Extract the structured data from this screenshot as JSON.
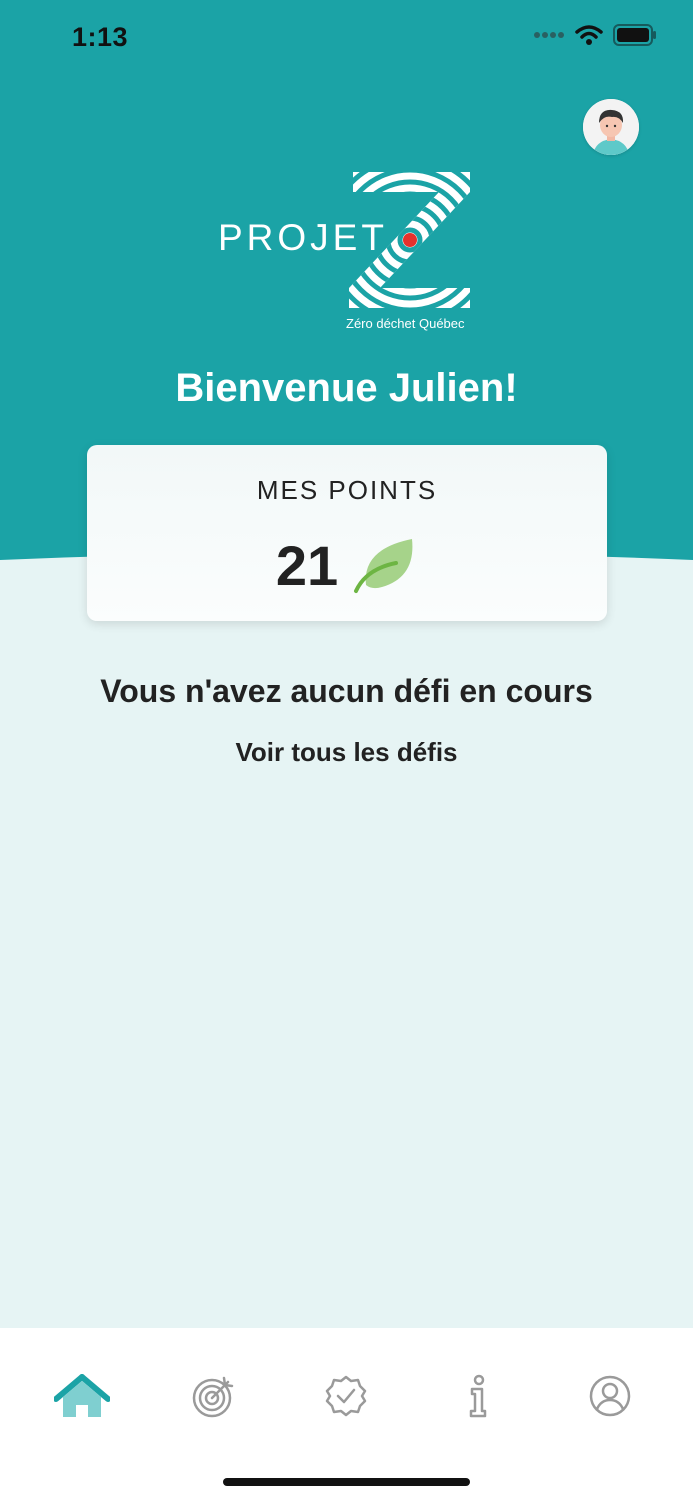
{
  "status_bar": {
    "time": "1:13"
  },
  "logo": {
    "wordmark": "PROJET",
    "tagline": "Zéro déchet Québec"
  },
  "welcome": "Bienvenue Julien!",
  "points": {
    "label": "MES POINTS",
    "value": "21"
  },
  "challenges": {
    "empty_message": "Vous n'avez aucun défi en cours",
    "see_all": "Voir tous les défis"
  },
  "tabs": [
    {
      "name": "home",
      "icon": "home-icon",
      "active": true
    },
    {
      "name": "challenges",
      "icon": "target-icon",
      "active": false
    },
    {
      "name": "achievements",
      "icon": "badge-check-icon",
      "active": false
    },
    {
      "name": "info",
      "icon": "info-icon",
      "active": false
    },
    {
      "name": "profile",
      "icon": "user-circle-icon",
      "active": false
    }
  ],
  "colors": {
    "brand_teal": "#1ba3a6",
    "background": "#e6f4f4",
    "leaf_green": "#a6d38a",
    "accent_red": "#e5322d",
    "inactive_icon": "#9a9a9a"
  }
}
